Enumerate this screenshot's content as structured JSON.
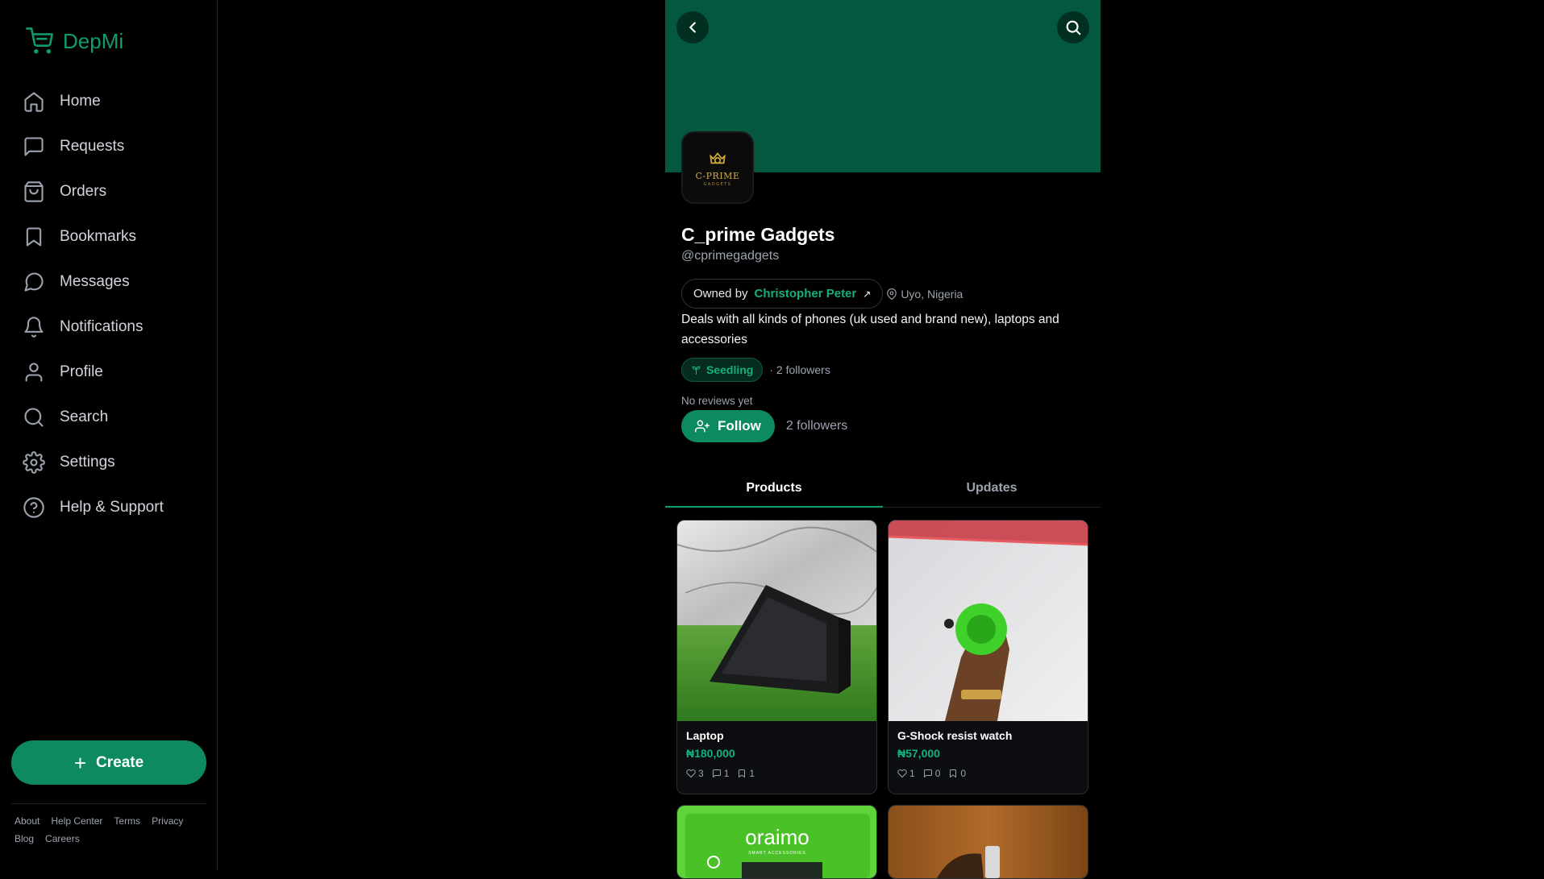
{
  "app": {
    "name": "DepMi"
  },
  "sidebar": {
    "items": [
      {
        "label": "Home",
        "icon": "home-icon"
      },
      {
        "label": "Requests",
        "icon": "message-square-icon"
      },
      {
        "label": "Orders",
        "icon": "shopping-bag-icon"
      },
      {
        "label": "Bookmarks",
        "icon": "bookmark-icon"
      },
      {
        "label": "Messages",
        "icon": "message-circle-icon"
      },
      {
        "label": "Notifications",
        "icon": "bell-icon"
      },
      {
        "label": "Profile",
        "icon": "user-icon"
      },
      {
        "label": "Search",
        "icon": "search-icon"
      },
      {
        "label": "Settings",
        "icon": "gear-icon"
      },
      {
        "label": "Help & Support",
        "icon": "help-circle-icon"
      }
    ],
    "create_label": "Create",
    "footer_links": [
      "About",
      "Help Center",
      "Terms",
      "Privacy",
      "Blog",
      "Careers"
    ]
  },
  "store": {
    "logo_text": "C-PRIME",
    "logo_subtext": "GADGETS",
    "name": "C_prime Gadgets",
    "handle": "@cprimegadgets",
    "owned_by_label": "Owned by",
    "owner_name": "Christopher Peter",
    "owner_link_icon": "↗",
    "location": "Uyo, Nigeria",
    "bio": "Deals with all kinds of phones (uk used and brand new), laptops and accessories",
    "badge": "Seedling",
    "badge_followers": "· 2 followers",
    "reviews": "No reviews yet",
    "follow_label": "Follow",
    "followers": "2 followers"
  },
  "tabs": [
    {
      "label": "Products",
      "active": true
    },
    {
      "label": "Updates",
      "active": false
    }
  ],
  "products": [
    {
      "title": "Laptop",
      "price": "₦180,000",
      "likes": "3",
      "comments": "1",
      "bookmarks": "1"
    },
    {
      "title": "G-Shock resist watch",
      "price": "₦57,000",
      "likes": "1",
      "comments": "0",
      "bookmarks": "0"
    }
  ],
  "partial_products": [
    {
      "brand_text": "oraimo",
      "brand_subtext": "SMART ACCESSORIES"
    },
    {}
  ],
  "colors": {
    "accent": "#0d8a5f",
    "accent_text": "#12b07a",
    "banner": "#03583f",
    "background": "#000000"
  }
}
